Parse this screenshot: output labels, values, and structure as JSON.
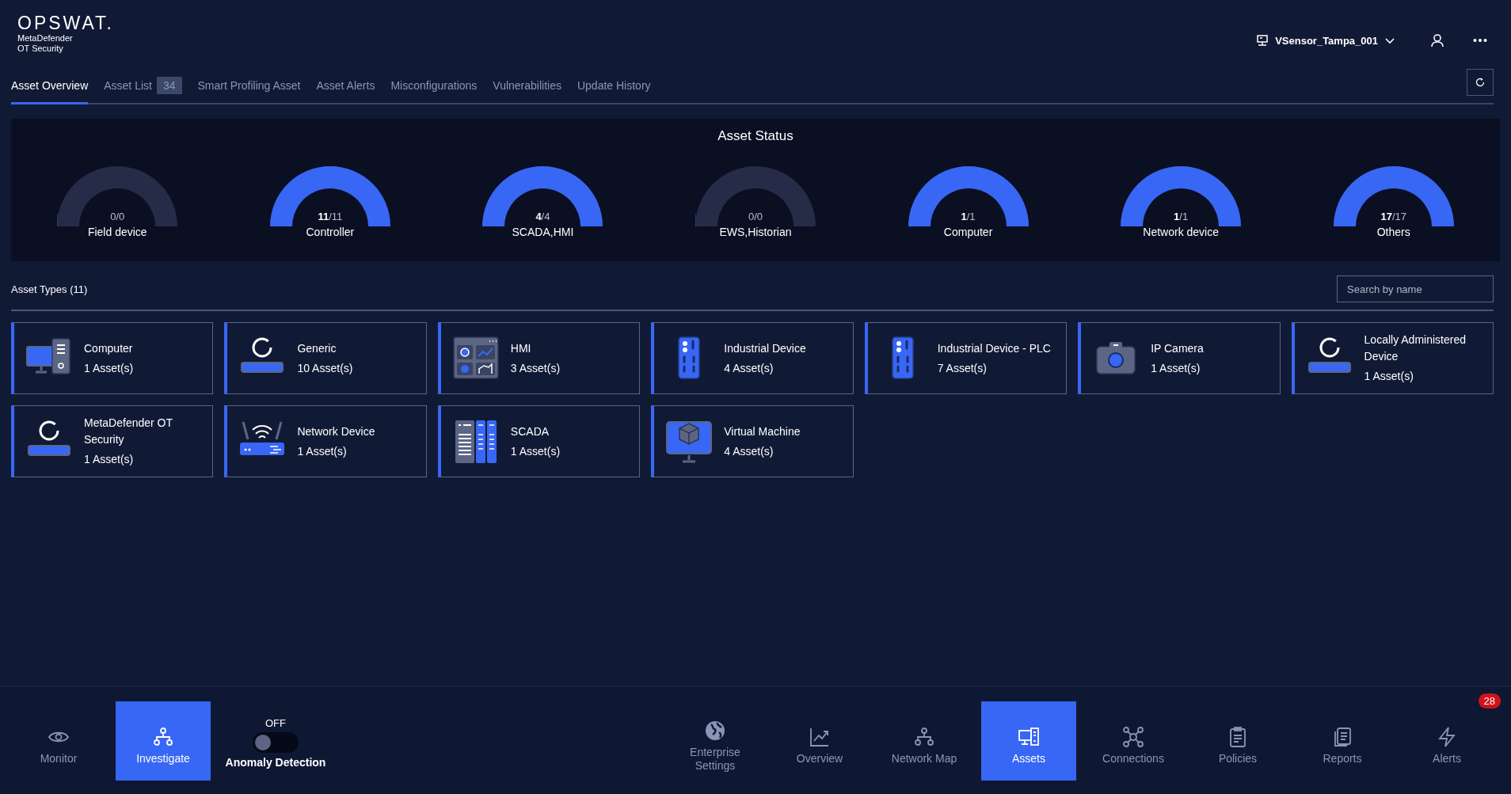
{
  "header": {
    "logo": "OPSWAT.",
    "product_line_1": "MetaDefender",
    "product_line_2": "OT Security",
    "sensor": "VSensor_Tampa_001"
  },
  "tabs": [
    {
      "label": "Asset Overview",
      "selected": true
    },
    {
      "label": "Asset List",
      "selected": false,
      "count": "34"
    },
    {
      "label": "Smart Profiling Asset",
      "selected": false
    },
    {
      "label": "Asset Alerts",
      "selected": false
    },
    {
      "label": "Misconfigurations",
      "selected": false
    },
    {
      "label": "Vulnerabilities",
      "selected": false
    },
    {
      "label": "Update History",
      "selected": false
    }
  ],
  "asset_status": {
    "title": "Asset Status",
    "gauges": [
      {
        "value": "0/0",
        "label": "Field device",
        "level": 0
      },
      {
        "value": "**11**/11",
        "label": "Controller",
        "level": 1
      },
      {
        "value": "**4**/4",
        "label": "SCADA,HMI",
        "level": 1
      },
      {
        "value": "0/0",
        "label": "EWS,Historian",
        "level": 0
      },
      {
        "value": "**1**/1",
        "label": "Computer",
        "level": 1
      },
      {
        "value": "**1**/1",
        "label": "Network device",
        "level": 1
      },
      {
        "value": "**17**/17",
        "label": "Others",
        "level": 1
      }
    ]
  },
  "asset_types": {
    "title": "Asset Types (11)",
    "search": {
      "placeholder": "Search by name"
    },
    "cards": [
      {
        "name": "Computer",
        "count": "1 Asset(s)"
      },
      {
        "name": "Generic",
        "count": "10 Asset(s)"
      },
      {
        "name": "HMI",
        "count": "3 Asset(s)"
      },
      {
        "name": "Industrial Device",
        "count": "4 Asset(s)"
      },
      {
        "name": "Industrial Device - PLC",
        "count": "7 Asset(s)"
      },
      {
        "name": "IP Camera",
        "count": "1 Asset(s)"
      },
      {
        "name": "Locally Administered Device",
        "count": "1 Asset(s)"
      },
      {
        "name": "MetaDefender OT Security",
        "count": "1 Asset(s)"
      },
      {
        "name": "Network Device",
        "count": "1 Asset(s)"
      },
      {
        "name": "SCADA",
        "count": "1 Asset(s)"
      },
      {
        "name": "Virtual Machine",
        "count": "4 Asset(s)"
      }
    ]
  },
  "mode_buttons": [
    {
      "label": "Monitor",
      "selected": false
    },
    {
      "label": "Investigate",
      "selected": true
    }
  ],
  "anomaly_detection": {
    "state_label": "OFF",
    "on": false,
    "label": "Anomaly Detection"
  },
  "nav_items": [
    {
      "label": "Enterprise Settings",
      "selected": false
    },
    {
      "label": "Overview",
      "selected": false
    },
    {
      "label": "Network Map",
      "selected": false
    },
    {
      "label": "Assets",
      "selected": true
    },
    {
      "label": "Connections",
      "selected": false
    },
    {
      "label": "Policies",
      "selected": false
    },
    {
      "label": "Reports",
      "selected": false
    },
    {
      "label": "Alerts",
      "selected": false,
      "badge": "28"
    }
  ]
}
